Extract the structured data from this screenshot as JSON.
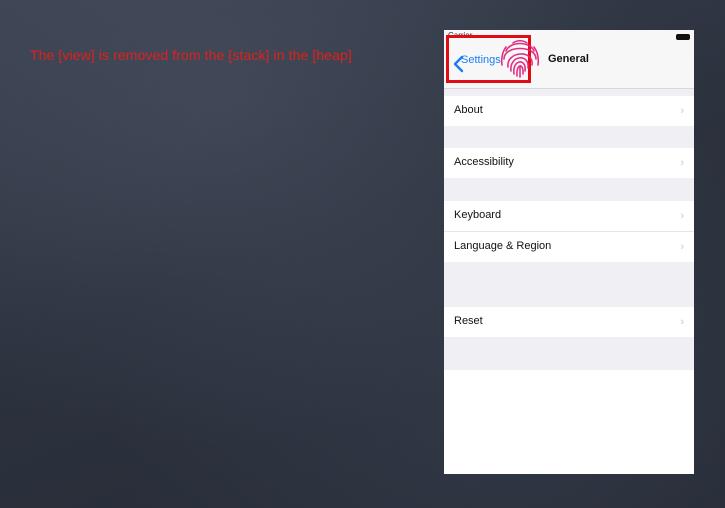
{
  "caption": "The [view] is removed from the [stack] in the [heap]",
  "status_bar": {
    "carrier": "Carrier"
  },
  "navbar": {
    "back_label": "Settings",
    "title": "General"
  },
  "rows": [
    {
      "label": "About",
      "chevron": "›"
    },
    {
      "label": "Accessibility",
      "chevron": "›"
    },
    {
      "label": "Keyboard",
      "chevron": "›"
    },
    {
      "label": "Language & Region",
      "chevron": "›"
    },
    {
      "label": "Reset",
      "chevron": "›"
    }
  ],
  "colors": {
    "accent": "#1b7cf4",
    "annotation": "#e10b14",
    "caption": "#e0201c",
    "fingerprint": "#e0207a"
  },
  "icons": {
    "back": "chevron-left-icon",
    "row": "chevron-right-icon",
    "touch": "fingerprint-icon"
  }
}
